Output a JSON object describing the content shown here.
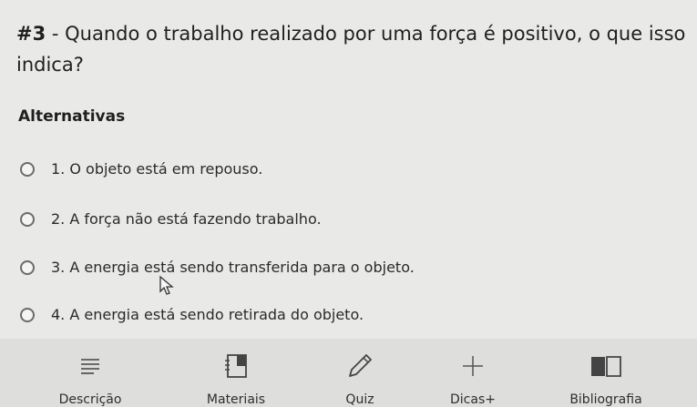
{
  "question": {
    "number": "#3",
    "text": " - Quando o trabalho realizado por uma força é positivo, o que isso indica?"
  },
  "section_title": "Alternativas",
  "options": [
    {
      "label": "1. O objeto está em repouso."
    },
    {
      "label": "2. A força não está fazendo trabalho."
    },
    {
      "label": "3. A energia está sendo transferida para o objeto."
    },
    {
      "label": "4. A energia está sendo retirada do objeto."
    }
  ],
  "nav": [
    {
      "label": "Descrição",
      "icon": "menu-lines-icon"
    },
    {
      "label": "Materiais",
      "icon": "document-icon"
    },
    {
      "label": "Quiz",
      "icon": "pencil-icon"
    },
    {
      "label": "Dicas+",
      "icon": "plus-icon"
    },
    {
      "label": "Bibliografia",
      "icon": "book-icon"
    }
  ],
  "colors": {
    "background": "#e9e9e7",
    "nav_background": "#dededc",
    "text": "#1f1f1f"
  }
}
